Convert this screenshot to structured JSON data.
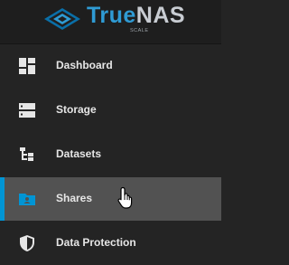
{
  "brand": {
    "name_part1": "True",
    "name_part2": "NAS",
    "edition": "SCALE",
    "logo_icon": "truenas-logo-icon"
  },
  "nav": {
    "items": [
      {
        "id": "dashboard",
        "label": "Dashboard",
        "icon": "dashboard-icon"
      },
      {
        "id": "storage",
        "label": "Storage",
        "icon": "storage-icon"
      },
      {
        "id": "datasets",
        "label": "Datasets",
        "icon": "datasets-icon"
      },
      {
        "id": "shares",
        "label": "Shares",
        "icon": "shares-icon",
        "active": true
      },
      {
        "id": "data-protection",
        "label": "Data Protection",
        "icon": "shield-icon"
      }
    ]
  },
  "colors": {
    "sidebar_bg": "#242424",
    "active_bg": "#525252",
    "accent": "#0095d5",
    "text": "#e6e6e6"
  }
}
